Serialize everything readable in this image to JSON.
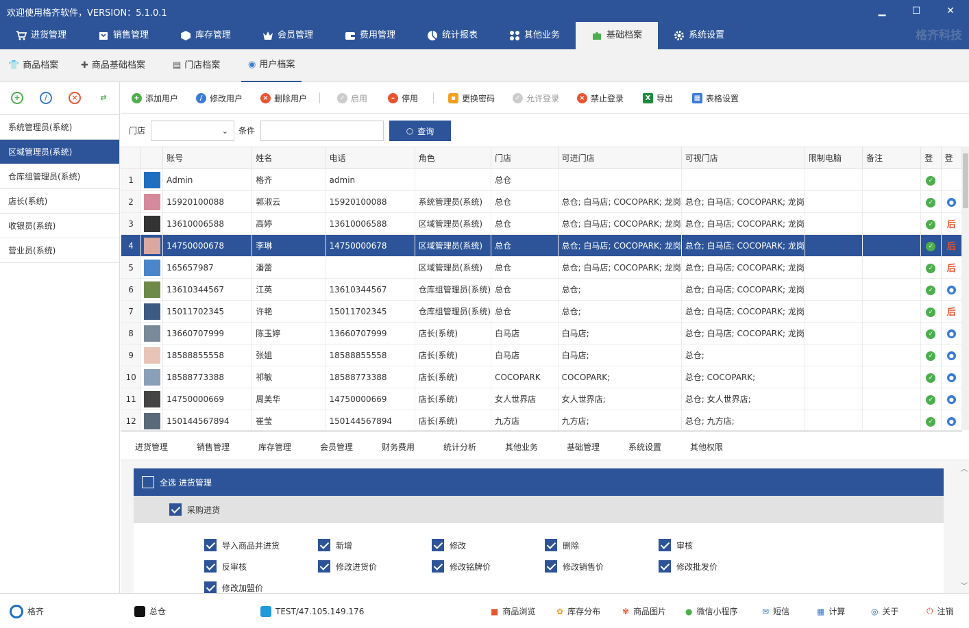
{
  "app": {
    "title": "欢迎使用格齐软件，VERSION：5.1.0.1",
    "brand": "格齐科技",
    "minimize": "▁",
    "maximize": "☐",
    "close": "✕"
  },
  "nav": [
    {
      "label": "进货管理",
      "icon": "cart-icon"
    },
    {
      "label": "销售管理",
      "icon": "store-icon"
    },
    {
      "label": "库存管理",
      "icon": "box-icon"
    },
    {
      "label": "会员管理",
      "icon": "crown-icon"
    },
    {
      "label": "费用管理",
      "icon": "wallet-icon"
    },
    {
      "label": "统计报表",
      "icon": "pie-icon"
    },
    {
      "label": "其他业务",
      "icon": "grid-icon"
    },
    {
      "label": "基础档案",
      "icon": "puzzle-icon"
    },
    {
      "label": "系统设置",
      "icon": "gear-icon"
    }
  ],
  "subtabs": [
    {
      "label": "商品档案"
    },
    {
      "label": "商品基础档案"
    },
    {
      "label": "门店档案"
    },
    {
      "label": "用户档案"
    }
  ],
  "roles": [
    "系统管理员(系统)",
    "区域管理员(系统)",
    "仓库组管理员(系统)",
    "店长(系统)",
    "收银员(系统)",
    "营业员(系统)"
  ],
  "toolbar": {
    "add": "添加用户",
    "edit": "修改用户",
    "delete": "删除用户",
    "enable": "启用",
    "disable": "停用",
    "password": "更换密码",
    "allow": "允许登录",
    "forbid": "禁止登录",
    "export": "导出",
    "tableset": "表格设置"
  },
  "filter": {
    "store_label": "门店",
    "cond_label": "条件",
    "query": "查询"
  },
  "columns": [
    "账号",
    "姓名",
    "电话",
    "角色",
    "门店",
    "可进门店",
    "可视门店",
    "限制电脑",
    "备注",
    "登",
    "登"
  ],
  "rows": [
    {
      "n": "1",
      "account": "Admin",
      "name": "格齐",
      "phone": "admin",
      "role": "",
      "store": "总仓",
      "enter": "",
      "view": "",
      "limit": "",
      "note": "",
      "st": "ok",
      "t": ""
    },
    {
      "n": "2",
      "account": "15920100088",
      "name": "郭淑云",
      "phone": "15920100088",
      "role": "系统管理员(系统)",
      "store": "总仓",
      "enter": "总仓; 白马店; COCOPARK; 龙岗",
      "view": "总仓; 白马店; COCOPARK; 龙岗",
      "limit": "",
      "note": "",
      "st": "ok",
      "t": "pc"
    },
    {
      "n": "3",
      "account": "13610006588",
      "name": "高婷",
      "phone": "13610006588",
      "role": "区域管理员(系统)",
      "store": "总仓",
      "enter": "总仓; 白马店; COCOPARK; 龙岗",
      "view": "总仓; 白马店; COCOPARK; 龙岗",
      "limit": "",
      "note": "",
      "st": "ok",
      "t": "bk"
    },
    {
      "n": "4",
      "account": "14750000678",
      "name": "李琳",
      "phone": "14750000678",
      "role": "区域管理员(系统)",
      "store": "总仓",
      "enter": "总仓; 白马店; COCOPARK; 龙岗",
      "view": "总仓; 白马店; COCOPARK; 龙岗",
      "limit": "",
      "note": "",
      "st": "ok",
      "t": "bk"
    },
    {
      "n": "5",
      "account": "165657987",
      "name": "潘蕾",
      "phone": "",
      "role": "区域管理员(系统)",
      "store": "总仓",
      "enter": "总仓; 白马店; COCOPARK; 龙岗",
      "view": "总仓; 白马店; COCOPARK; 龙岗",
      "limit": "",
      "note": "",
      "st": "ok",
      "t": "bk"
    },
    {
      "n": "6",
      "account": "13610344567",
      "name": "江英",
      "phone": "13610344567",
      "role": "仓库组管理员(系统)",
      "store": "总仓",
      "enter": "总仓;",
      "view": "总仓; 白马店; COCOPARK; 龙岗",
      "limit": "",
      "note": "",
      "st": "ok",
      "t": "pc"
    },
    {
      "n": "7",
      "account": "15011702345",
      "name": "许艳",
      "phone": "15011702345",
      "role": "仓库组管理员(系统)",
      "store": "总仓",
      "enter": "总仓;",
      "view": "总仓; 白马店; COCOPARK; 龙岗",
      "limit": "",
      "note": "",
      "st": "ok",
      "t": "bk"
    },
    {
      "n": "8",
      "account": "13660707999",
      "name": "陈玉婷",
      "phone": "13660707999",
      "role": "店长(系统)",
      "store": "白马店",
      "enter": "白马店;",
      "view": "总仓; 白马店; COCOPARK; 龙岗",
      "limit": "",
      "note": "",
      "st": "ok",
      "t": "pc"
    },
    {
      "n": "9",
      "account": "18588855558",
      "name": "张姐",
      "phone": "18588855558",
      "role": "店长(系统)",
      "store": "白马店",
      "enter": "白马店;",
      "view": "总仓;",
      "limit": "",
      "note": "",
      "st": "ok",
      "t": "pc"
    },
    {
      "n": "10",
      "account": "18588773388",
      "name": "祁敏",
      "phone": "18588773388",
      "role": "店长(系统)",
      "store": "COCOPARK",
      "enter": "COCOPARK;",
      "view": "总仓; COCOPARK;",
      "limit": "",
      "note": "",
      "st": "ok",
      "t": "pc"
    },
    {
      "n": "11",
      "account": "14750000669",
      "name": "周美华",
      "phone": "14750000669",
      "role": "店长(系统)",
      "store": "女人世界店",
      "enter": "女人世界店;",
      "view": "总仓; 女人世界店;",
      "limit": "",
      "note": "",
      "st": "ok",
      "t": "pc"
    },
    {
      "n": "12",
      "account": "150144567894",
      "name": "崔莹",
      "phone": "150144567894",
      "role": "店长(系统)",
      "store": "九方店",
      "enter": "九方店;",
      "view": "总仓; 九方店;",
      "limit": "",
      "note": "",
      "st": "ok",
      "t": "pc"
    }
  ],
  "avatar_colors": [
    "#1e6fbf",
    "#d48a9a",
    "#333333",
    "#d9a8a0",
    "#4a86c8",
    "#6e8a4a",
    "#3d5a80",
    "#7a8a99",
    "#e8c4b8",
    "#8aa0b8",
    "#444444",
    "#5a6a7a"
  ],
  "permtabs": [
    "进货管理",
    "销售管理",
    "库存管理",
    "会员管理",
    "财务费用",
    "统计分析",
    "其他业务",
    "基础管理",
    "系统设置",
    "其他权限"
  ],
  "perm": {
    "head": "全选 进货管理",
    "group": "采购进货",
    "items": [
      "导入商品并进货",
      "新增",
      "修改",
      "删除",
      "审核",
      "反审核",
      "修改进货价",
      "修改铭牌价",
      "修改销售价",
      "修改批发价",
      "修改加盟价"
    ]
  },
  "status": {
    "user": "格齐",
    "store": "总仓",
    "server": "TEST/47.105.149.176",
    "links": [
      "商品浏览",
      "库存分布",
      "商品图片",
      "微信小程序",
      "短信",
      "计算",
      "关于",
      "注销"
    ]
  }
}
